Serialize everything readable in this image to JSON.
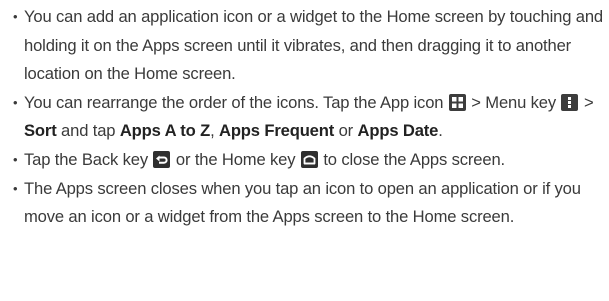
{
  "bullet_glyph": "•",
  "items": [
    {
      "text": "You can add an application icon or a widget to the Home screen by touching and holding it on the Apps screen until it vibrates, and then dragging it to another location on the Home screen."
    },
    {
      "part1": "You can rearrange the order of the icons. Tap the App icon ",
      "part2": " > Menu key ",
      "part3": " > ",
      "sort": "Sort",
      "part4": " and tap ",
      "apps_a_to_z": "Apps A to Z",
      "part5": ", ",
      "apps_frequent": "Apps Frequent",
      "part6": " or ",
      "apps_date": "Apps Date",
      "part7": "."
    },
    {
      "part1": "Tap the Back key ",
      "part2": " or the Home key ",
      "part3": " to close the Apps screen."
    },
    {
      "text": "The Apps screen closes when you tap an icon to open an application or if you move an icon or a widget from the Apps screen to the Home screen."
    }
  ],
  "icons": {
    "app": "apps-grid-icon",
    "menu": "menu-key-icon",
    "back": "back-key-icon",
    "home": "home-key-icon"
  },
  "colors": {
    "text": "#3a3a3a",
    "bold_text": "#222222",
    "key_background": "#3d3d3d",
    "icon_glyph": "#ffffff"
  }
}
